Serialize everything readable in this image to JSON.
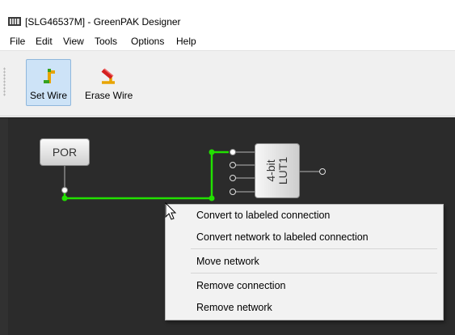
{
  "window": {
    "title": "[SLG46537M] - GreenPAK Designer",
    "icon": "greenpak-app-icon"
  },
  "menubar": {
    "items": [
      "File",
      "Edit",
      "View",
      "Tools",
      "Options",
      "Help"
    ]
  },
  "toolbar": {
    "set_wire_label": "Set Wire",
    "set_wire_icon": "set-wire-icon",
    "set_wire_active": true,
    "erase_wire_label": "Erase Wire",
    "erase_wire_icon": "erase-wire-icon"
  },
  "canvas": {
    "background": "#2b2b2b",
    "wire_color": "#22e000",
    "blocks": {
      "por_label": "POR",
      "lut_label_line1": "4-bit",
      "lut_label_line2": "LUT1"
    }
  },
  "context_menu": {
    "items": [
      "Convert to labeled connection",
      "Convert network to labeled connection",
      "Move network",
      "Remove connection",
      "Remove network"
    ]
  }
}
